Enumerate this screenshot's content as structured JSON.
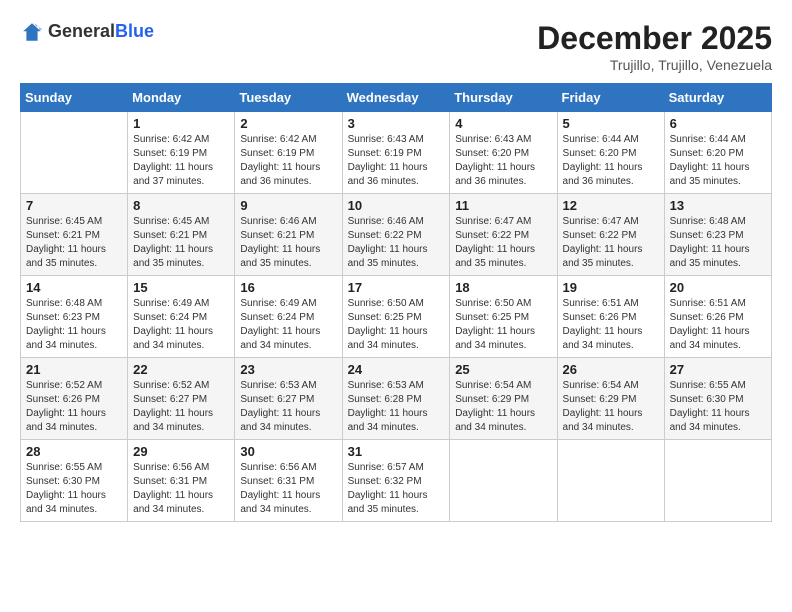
{
  "header": {
    "logo_general": "General",
    "logo_blue": "Blue",
    "month_title": "December 2025",
    "location": "Trujillo, Trujillo, Venezuela"
  },
  "weekdays": [
    "Sunday",
    "Monday",
    "Tuesday",
    "Wednesday",
    "Thursday",
    "Friday",
    "Saturday"
  ],
  "weeks": [
    [
      {
        "day": "",
        "sunrise": "",
        "sunset": "",
        "daylight": ""
      },
      {
        "day": "1",
        "sunrise": "Sunrise: 6:42 AM",
        "sunset": "Sunset: 6:19 PM",
        "daylight": "Daylight: 11 hours and 37 minutes."
      },
      {
        "day": "2",
        "sunrise": "Sunrise: 6:42 AM",
        "sunset": "Sunset: 6:19 PM",
        "daylight": "Daylight: 11 hours and 36 minutes."
      },
      {
        "day": "3",
        "sunrise": "Sunrise: 6:43 AM",
        "sunset": "Sunset: 6:19 PM",
        "daylight": "Daylight: 11 hours and 36 minutes."
      },
      {
        "day": "4",
        "sunrise": "Sunrise: 6:43 AM",
        "sunset": "Sunset: 6:20 PM",
        "daylight": "Daylight: 11 hours and 36 minutes."
      },
      {
        "day": "5",
        "sunrise": "Sunrise: 6:44 AM",
        "sunset": "Sunset: 6:20 PM",
        "daylight": "Daylight: 11 hours and 36 minutes."
      },
      {
        "day": "6",
        "sunrise": "Sunrise: 6:44 AM",
        "sunset": "Sunset: 6:20 PM",
        "daylight": "Daylight: 11 hours and 35 minutes."
      }
    ],
    [
      {
        "day": "7",
        "sunrise": "Sunrise: 6:45 AM",
        "sunset": "Sunset: 6:21 PM",
        "daylight": "Daylight: 11 hours and 35 minutes."
      },
      {
        "day": "8",
        "sunrise": "Sunrise: 6:45 AM",
        "sunset": "Sunset: 6:21 PM",
        "daylight": "Daylight: 11 hours and 35 minutes."
      },
      {
        "day": "9",
        "sunrise": "Sunrise: 6:46 AM",
        "sunset": "Sunset: 6:21 PM",
        "daylight": "Daylight: 11 hours and 35 minutes."
      },
      {
        "day": "10",
        "sunrise": "Sunrise: 6:46 AM",
        "sunset": "Sunset: 6:22 PM",
        "daylight": "Daylight: 11 hours and 35 minutes."
      },
      {
        "day": "11",
        "sunrise": "Sunrise: 6:47 AM",
        "sunset": "Sunset: 6:22 PM",
        "daylight": "Daylight: 11 hours and 35 minutes."
      },
      {
        "day": "12",
        "sunrise": "Sunrise: 6:47 AM",
        "sunset": "Sunset: 6:22 PM",
        "daylight": "Daylight: 11 hours and 35 minutes."
      },
      {
        "day": "13",
        "sunrise": "Sunrise: 6:48 AM",
        "sunset": "Sunset: 6:23 PM",
        "daylight": "Daylight: 11 hours and 35 minutes."
      }
    ],
    [
      {
        "day": "14",
        "sunrise": "Sunrise: 6:48 AM",
        "sunset": "Sunset: 6:23 PM",
        "daylight": "Daylight: 11 hours and 34 minutes."
      },
      {
        "day": "15",
        "sunrise": "Sunrise: 6:49 AM",
        "sunset": "Sunset: 6:24 PM",
        "daylight": "Daylight: 11 hours and 34 minutes."
      },
      {
        "day": "16",
        "sunrise": "Sunrise: 6:49 AM",
        "sunset": "Sunset: 6:24 PM",
        "daylight": "Daylight: 11 hours and 34 minutes."
      },
      {
        "day": "17",
        "sunrise": "Sunrise: 6:50 AM",
        "sunset": "Sunset: 6:25 PM",
        "daylight": "Daylight: 11 hours and 34 minutes."
      },
      {
        "day": "18",
        "sunrise": "Sunrise: 6:50 AM",
        "sunset": "Sunset: 6:25 PM",
        "daylight": "Daylight: 11 hours and 34 minutes."
      },
      {
        "day": "19",
        "sunrise": "Sunrise: 6:51 AM",
        "sunset": "Sunset: 6:26 PM",
        "daylight": "Daylight: 11 hours and 34 minutes."
      },
      {
        "day": "20",
        "sunrise": "Sunrise: 6:51 AM",
        "sunset": "Sunset: 6:26 PM",
        "daylight": "Daylight: 11 hours and 34 minutes."
      }
    ],
    [
      {
        "day": "21",
        "sunrise": "Sunrise: 6:52 AM",
        "sunset": "Sunset: 6:26 PM",
        "daylight": "Daylight: 11 hours and 34 minutes."
      },
      {
        "day": "22",
        "sunrise": "Sunrise: 6:52 AM",
        "sunset": "Sunset: 6:27 PM",
        "daylight": "Daylight: 11 hours and 34 minutes."
      },
      {
        "day": "23",
        "sunrise": "Sunrise: 6:53 AM",
        "sunset": "Sunset: 6:27 PM",
        "daylight": "Daylight: 11 hours and 34 minutes."
      },
      {
        "day": "24",
        "sunrise": "Sunrise: 6:53 AM",
        "sunset": "Sunset: 6:28 PM",
        "daylight": "Daylight: 11 hours and 34 minutes."
      },
      {
        "day": "25",
        "sunrise": "Sunrise: 6:54 AM",
        "sunset": "Sunset: 6:29 PM",
        "daylight": "Daylight: 11 hours and 34 minutes."
      },
      {
        "day": "26",
        "sunrise": "Sunrise: 6:54 AM",
        "sunset": "Sunset: 6:29 PM",
        "daylight": "Daylight: 11 hours and 34 minutes."
      },
      {
        "day": "27",
        "sunrise": "Sunrise: 6:55 AM",
        "sunset": "Sunset: 6:30 PM",
        "daylight": "Daylight: 11 hours and 34 minutes."
      }
    ],
    [
      {
        "day": "28",
        "sunrise": "Sunrise: 6:55 AM",
        "sunset": "Sunset: 6:30 PM",
        "daylight": "Daylight: 11 hours and 34 minutes."
      },
      {
        "day": "29",
        "sunrise": "Sunrise: 6:56 AM",
        "sunset": "Sunset: 6:31 PM",
        "daylight": "Daylight: 11 hours and 34 minutes."
      },
      {
        "day": "30",
        "sunrise": "Sunrise: 6:56 AM",
        "sunset": "Sunset: 6:31 PM",
        "daylight": "Daylight: 11 hours and 34 minutes."
      },
      {
        "day": "31",
        "sunrise": "Sunrise: 6:57 AM",
        "sunset": "Sunset: 6:32 PM",
        "daylight": "Daylight: 11 hours and 35 minutes."
      },
      {
        "day": "",
        "sunrise": "",
        "sunset": "",
        "daylight": ""
      },
      {
        "day": "",
        "sunrise": "",
        "sunset": "",
        "daylight": ""
      },
      {
        "day": "",
        "sunrise": "",
        "sunset": "",
        "daylight": ""
      }
    ]
  ]
}
